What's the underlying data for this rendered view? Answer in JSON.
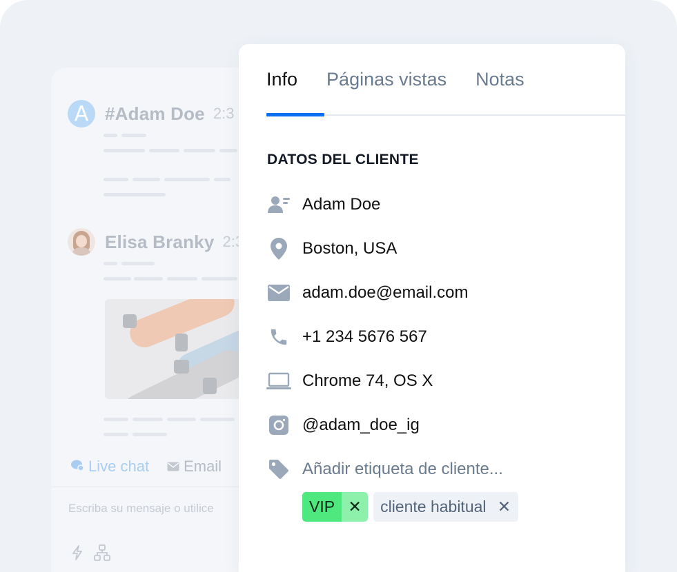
{
  "chat": {
    "messages": [
      {
        "avatar_letter": "A",
        "name": "#Adam Doe",
        "time": "2:3"
      },
      {
        "name": "Elisa Branky",
        "time": "2:3"
      }
    ],
    "tabs": [
      {
        "label": "Live chat",
        "icon": "chat-bubble-icon",
        "active": true
      },
      {
        "label": "Email",
        "icon": "envelope-icon",
        "active": false
      }
    ],
    "composer_placeholder": "Escriba su mensaje o utilice",
    "tools": [
      "lightning-icon",
      "workflow-icon"
    ]
  },
  "info_panel": {
    "tabs": [
      {
        "label": "Info",
        "active": true
      },
      {
        "label": "Páginas vistas",
        "active": false
      },
      {
        "label": "Notas",
        "active": false
      }
    ],
    "section_title": "DATOS DEL CLIENTE",
    "fields": [
      {
        "icon": "contact-card-icon",
        "value": "Adam Doe"
      },
      {
        "icon": "location-pin-icon",
        "value": "Boston, USA"
      },
      {
        "icon": "envelope-icon",
        "value": "adam.doe@email.com"
      },
      {
        "icon": "phone-icon",
        "value": "+1 234 5676 567"
      },
      {
        "icon": "laptop-icon",
        "value": "Chrome 74, OS X"
      },
      {
        "icon": "instagram-icon",
        "value": "@adam_doe_ig"
      }
    ],
    "add_tag": {
      "icon": "tag-icon",
      "label": "Añadir etiqueta de cliente..."
    },
    "tags": [
      {
        "label": "VIP",
        "remove": "✕",
        "color": "#4ee87e"
      },
      {
        "label": "cliente habitual",
        "remove": "✕",
        "color": "#eef1f5"
      }
    ]
  },
  "colors": {
    "accent": "#0a6ff0",
    "icon_gray": "#9aa8b9",
    "vip_green": "#4ee87e"
  }
}
